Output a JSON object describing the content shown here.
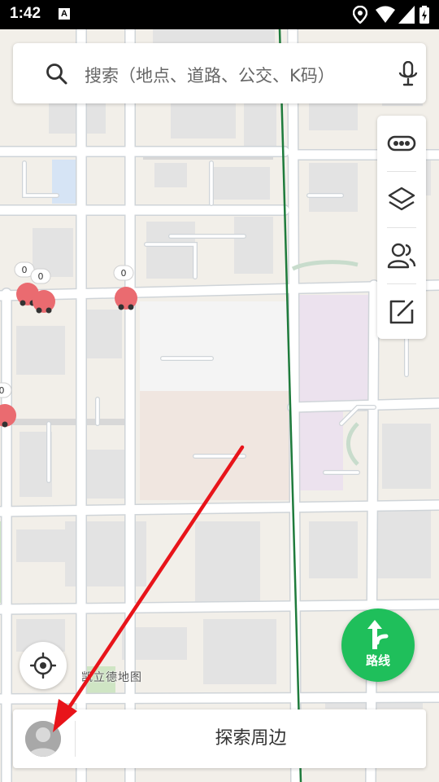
{
  "status_bar": {
    "time": "1:42",
    "notification_letter": "A"
  },
  "search": {
    "placeholder": "搜索（地点、道路、公交、K码）"
  },
  "tools": [
    {
      "name": "more-icon"
    },
    {
      "name": "layers-icon"
    },
    {
      "name": "team-icon"
    },
    {
      "name": "feedback-icon"
    }
  ],
  "map": {
    "poi_label": "凯立德地图",
    "markers": [
      {
        "count": "0"
      },
      {
        "count": "0"
      },
      {
        "count": "0"
      },
      {
        "count": "0"
      }
    ],
    "road_color": "#ffffff",
    "rail_color": "#1e7b3c"
  },
  "route_button": {
    "label": "路线",
    "color": "#1fbf5b"
  },
  "bottom": {
    "explore_label": "探索周边"
  },
  "annotation": {
    "color": "#e8141a"
  }
}
